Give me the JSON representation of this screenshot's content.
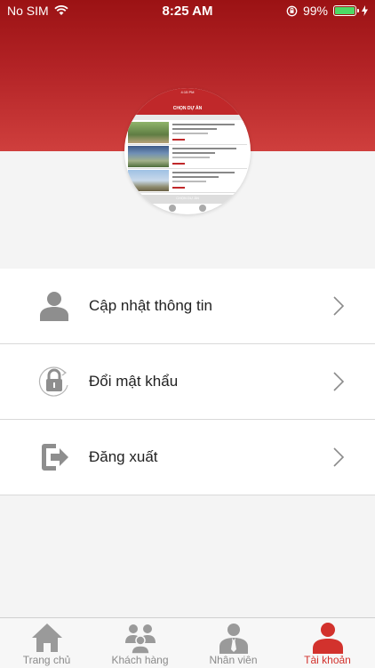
{
  "status_bar": {
    "carrier": "No SIM",
    "time": "8:25 AM",
    "battery": "99%",
    "battery_level": 0.99
  },
  "preview": {
    "time": "4:15 PM",
    "title": "CHỌN DỰ ÁN",
    "bottom": "CHỌN DỰ ÁN"
  },
  "menu": [
    {
      "label": "Cập nhật thông tin",
      "icon": "user-icon"
    },
    {
      "label": "Đổi mật khẩu",
      "icon": "lock-icon"
    },
    {
      "label": "Đăng xuất",
      "icon": "logout-icon"
    }
  ],
  "tabs": [
    {
      "label": "Trang chủ",
      "icon": "home-icon",
      "active": false
    },
    {
      "label": "Khách hàng",
      "icon": "customers-icon",
      "active": false
    },
    {
      "label": "Nhân viên",
      "icon": "employee-icon",
      "active": false
    },
    {
      "label": "Tài khoản",
      "icon": "account-icon",
      "active": true
    }
  ],
  "colors": {
    "brand": "#b32326",
    "active_tab": "#d2322d",
    "inactive_tab": "#8a8a8a",
    "icon_gray": "#8e8e8e"
  }
}
